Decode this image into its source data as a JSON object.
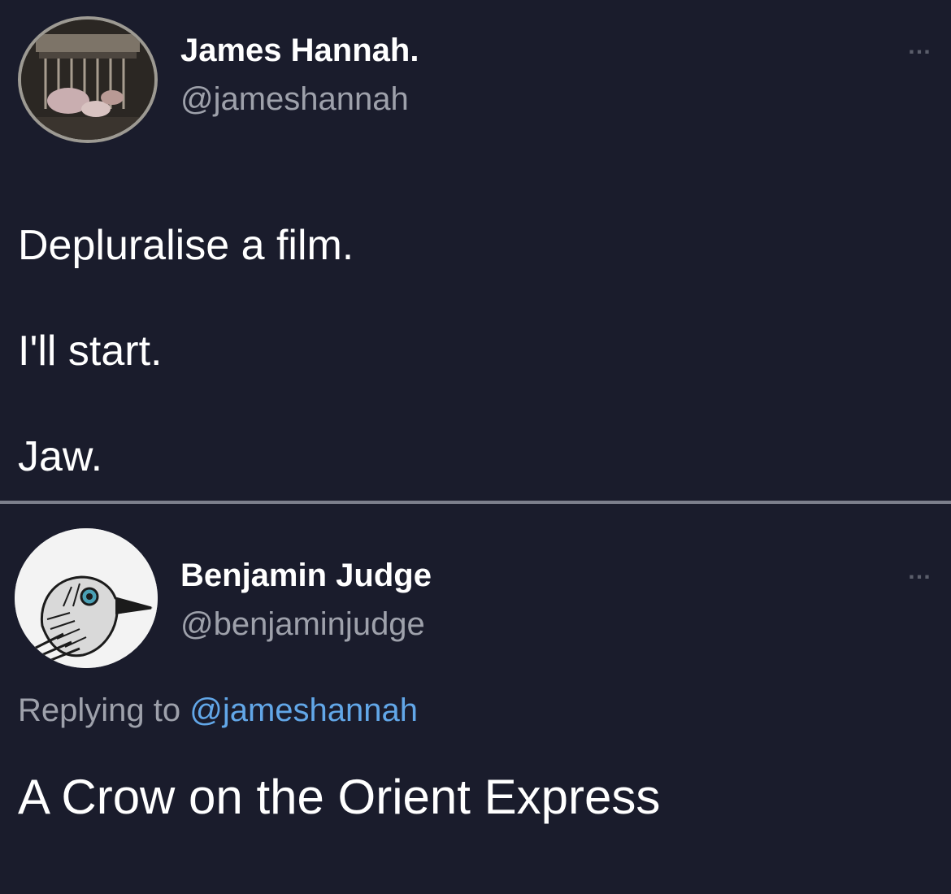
{
  "tweets": [
    {
      "author_name": "James Hannah.",
      "handle": "@jameshannah",
      "more_icon": "…",
      "lines": [
        "Depluralise a film.",
        "I'll start.",
        "Jaw."
      ]
    },
    {
      "author_name": "Benjamin Judge",
      "handle": "@benjaminjudge",
      "more_icon": "…",
      "replying_label": "Replying to",
      "replying_to": "@jameshannah",
      "text": "A Crow on the Orient Express"
    }
  ],
  "colors": {
    "background": "#1a1c2c",
    "primary_text": "#ffffff",
    "secondary_text": "#9ea1ab",
    "mention": "#62a7e8",
    "divider": "#7c7f8c"
  },
  "icons": {
    "avatar_1": "avatar-photo-icon",
    "avatar_2": "crow-avatar-icon",
    "more": "more-options-icon"
  }
}
